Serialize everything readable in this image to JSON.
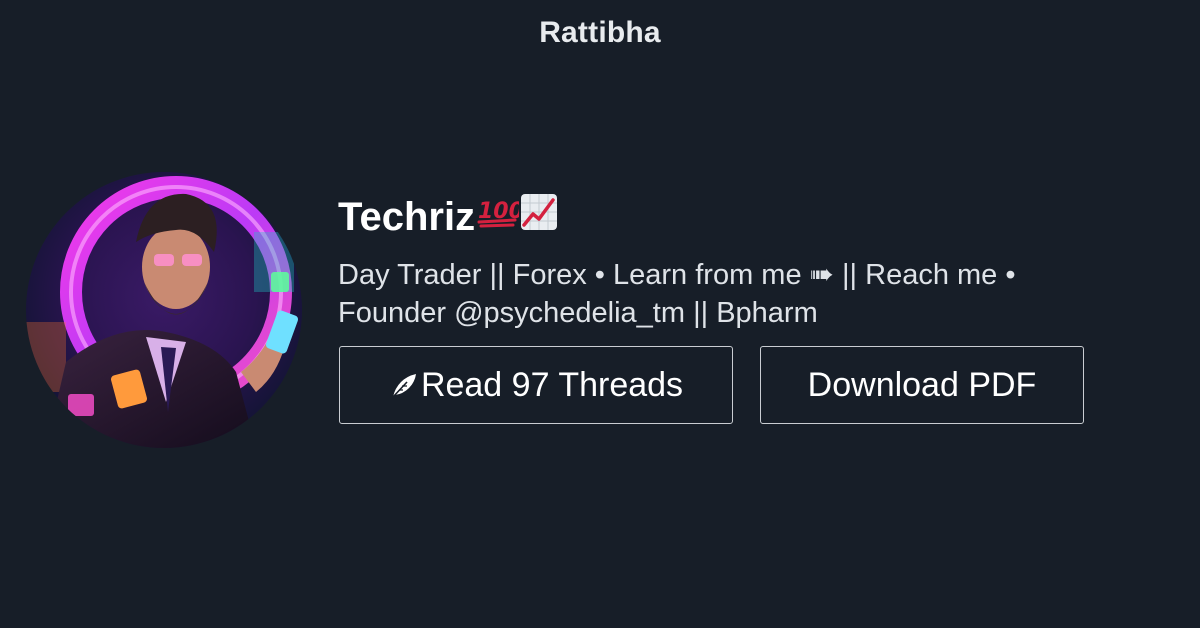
{
  "site": {
    "title": "Rattibha"
  },
  "profile": {
    "name": "Techriz",
    "name_emojis": [
      "hundred-points-icon",
      "chart-increasing-icon"
    ],
    "bio_line1": "Day Trader || Forex • Learn from me ➠ || Reach me •",
    "bio_line2": "Founder @psychedelia_tm || Bpharm"
  },
  "actions": {
    "read_label": "Read 97 Threads",
    "read_icon": "feather-icon",
    "download_label": "Download PDF"
  },
  "colors": {
    "background": "#171e28",
    "text": "#ffffff",
    "muted_text": "#dfe3e8",
    "button_border": "#c9cdd2",
    "hundred_red": "#d4213f"
  }
}
